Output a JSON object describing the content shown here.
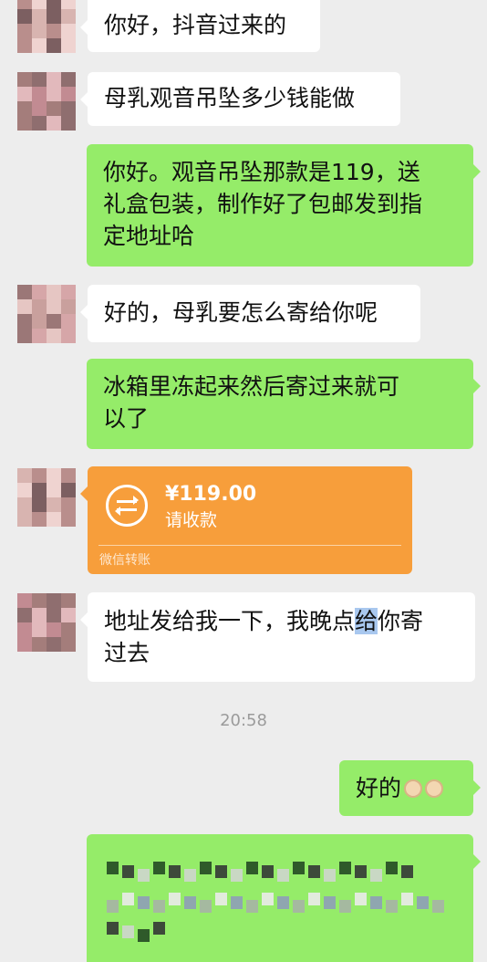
{
  "chat": {
    "messages": [
      {
        "from": "contact",
        "text": "你好，抖音过来的"
      },
      {
        "from": "contact",
        "text": "母乳观音吊坠多少钱能做"
      },
      {
        "from": "me",
        "lines": [
          "你好。观音吊坠那款是119，送",
          "礼盒包装，制作好了包邮发到指",
          "定地址哈"
        ]
      },
      {
        "from": "contact",
        "text": "好的，母乳要怎么寄给你呢"
      },
      {
        "from": "me",
        "lines": [
          "冰箱里冻起来然后寄过来就可",
          "以了"
        ]
      },
      {
        "from": "contact",
        "type": "transfer",
        "amount": "¥119.00",
        "status": "请收款",
        "footer": "微信转账"
      },
      {
        "from": "contact",
        "line1_before": "地址发给我一下，我晚点",
        "line1_highlight": "给",
        "line1_after": "你寄",
        "line2": "过去"
      },
      {
        "type": "time",
        "text": "20:58"
      },
      {
        "from": "me",
        "text": "好的",
        "emoji": "ok-hand-emoji ok-hand-emoji"
      },
      {
        "from": "me",
        "type": "blurred",
        "text": ""
      }
    ]
  },
  "colors": {
    "background": "#ededed",
    "incoming_bubble": "#ffffff",
    "outgoing_bubble": "#95ec69",
    "transfer_bubble": "#f79e3b",
    "highlight": "#a9c8ef"
  }
}
